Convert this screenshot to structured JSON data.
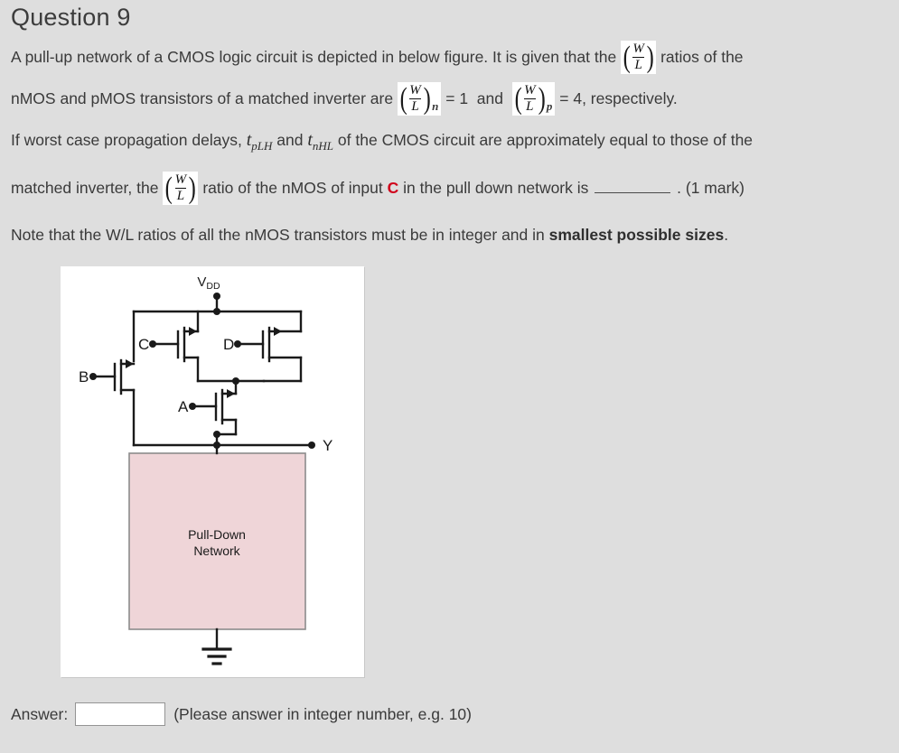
{
  "question": {
    "title": "Question 9",
    "paragraph1_part1": "A pull-up network of a CMOS logic circuit is depicted in below figure. It is given that the",
    "paragraph1_part2": "ratios of the",
    "paragraph2_part1": "nMOS and pMOS transistors of a matched inverter are",
    "paragraph2_sub_n": "n",
    "paragraph2_eq1": "= 1",
    "paragraph2_and": "and",
    "paragraph2_sub_p": "p",
    "paragraph2_eq2": "= 4, respectively.",
    "paragraph3_part1": "If worst case propagation delays,",
    "paragraph3_t1": "t",
    "paragraph3_t1_sub": "pLH",
    "paragraph3_and": "and",
    "paragraph3_t2": "t",
    "paragraph3_t2_sub": "nHL",
    "paragraph3_part2": "of the CMOS circuit are approximately equal to those of the",
    "paragraph4_part1": "matched inverter, the",
    "paragraph4_part2": "ratio of the nMOS of input",
    "paragraph4_input": "C",
    "paragraph4_part3": "in the pull down network is",
    "paragraph4_marks": ". (1 mark)",
    "note_part1": "Note that the W/L ratios of all the nMOS transistors must be in integer and in",
    "note_bold": "smallest possible sizes",
    "note_end": ".",
    "fraction": {
      "numerator": "W",
      "denominator": "L",
      "left_paren": "(",
      "right_paren": ")"
    }
  },
  "figure": {
    "supply_label": "V",
    "supply_sub": "DD",
    "output_label": "Y",
    "gate_labels": {
      "b": "B",
      "c": "C",
      "d": "D",
      "a": "A"
    },
    "pulldown_line1": "Pull-Down",
    "pulldown_line2": "Network",
    "colors": {
      "background": "#ffffff",
      "wire": "#1a1a1a",
      "pulldown_fill": "#efd5d8",
      "pulldown_stroke": "#8c8c8c"
    }
  },
  "answer": {
    "label": "Answer:",
    "value": "",
    "placeholder": "",
    "hint": "(Please answer in integer number, e.g. 10)"
  },
  "theme": {
    "page_background": "#dedede",
    "text_color": "#3a3a3a",
    "accent_red": "#d0021b"
  }
}
